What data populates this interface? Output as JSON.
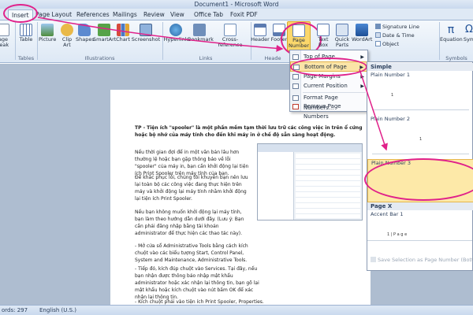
{
  "window": {
    "title": "Document1 - Microsoft Word"
  },
  "tabs": [
    "Insert",
    "Page Layout",
    "References",
    "Mailings",
    "Review",
    "View",
    "Office Tab",
    "Foxit PDF"
  ],
  "ribbon": {
    "buttons": [
      "Table",
      "Picture",
      "Clip Art",
      "Shapes",
      "SmartArt",
      "Chart",
      "Screenshot",
      "Hyperlink",
      "Bookmark",
      "Cross-reference",
      "Header",
      "Footer",
      "Page Number",
      "Text Box",
      "Quick Parts",
      "WordArt",
      "Equation",
      "Sym"
    ],
    "left_partial": [
      "age",
      "reak"
    ],
    "small_items": [
      "Signature Line",
      "Date & Time",
      "Object"
    ],
    "groups": [
      "Tables",
      "Illustrations",
      "Links",
      "Heade",
      "Symbols"
    ]
  },
  "menu": {
    "items": [
      "Top of Page",
      "Bottom of Page",
      "Page Margins",
      "Current Position",
      "Format Page Numbers...",
      "Remove Page Numbers"
    ]
  },
  "gallery": {
    "header": "Simple",
    "items": [
      "Plain Number 1",
      "Plain Number 2",
      "Plain Number 3"
    ],
    "section2": "Page X",
    "item4": "Accent Bar 1",
    "numbers": [
      "1",
      "1",
      "1 | P a g e"
    ],
    "save_label": "Save Selection as Page Number (Bottom)"
  },
  "document": {
    "title": "TP - Tiện ích \"spooler\" là một phần mềm tạm thời lưu trữ các công việc in trên ổ cứng hoặc bộ nhớ của máy tính cho đến khi máy in ở chế độ sẵn sàng hoạt động.",
    "paragraphs": [
      "Nếu thời gian đợi để in một văn bản lâu hơn thường lệ hoặc bạn gặp thông báo về lỗi \"spooler\" của máy in, bạn cần khởi động lại tiện ích Print Spooler trên máy tính của bạn.",
      "Để khắc phục lỗi, chúng tôi khuyên bạn nên lưu lại toàn bộ các công việc đang thực hiện trên máy và khởi động lại máy tính nhằm khởi động lại tiện ích Print Spooler.",
      "Nếu bạn không muốn khởi động lại máy tính, bạn làm theo hướng dẫn dưới đây. (Lưu ý: Bạn cần phải đăng nhập bằng tài khoản administrator để thực hiện các thao tác này).",
      "- Mở cửa sổ Administrative Tools bằng cách kích chuột vào các biểu tượng Start, Control Panel, System and Maintenance, Administrative Tools.",
      "- Tiếp đó, kích đúp chuột vào Services. Tại đây, nếu bạn nhận được thông báo nhập mật khẩu administrator hoặc xác nhận lại thông tin, bạn gõ lại mật khẩu hoặc kích chuột vào nút bấm OK để xác nhận lại thông tin.",
      "- Kích chuột phải vào tiện ích Print Spooler, Properties."
    ]
  },
  "status": {
    "words": "ords: 297",
    "language": "English (U.S.)"
  },
  "colors": {
    "annotation": "#e0218a",
    "highlight": "#fbd76b",
    "ribbon": "#dde8f5"
  }
}
